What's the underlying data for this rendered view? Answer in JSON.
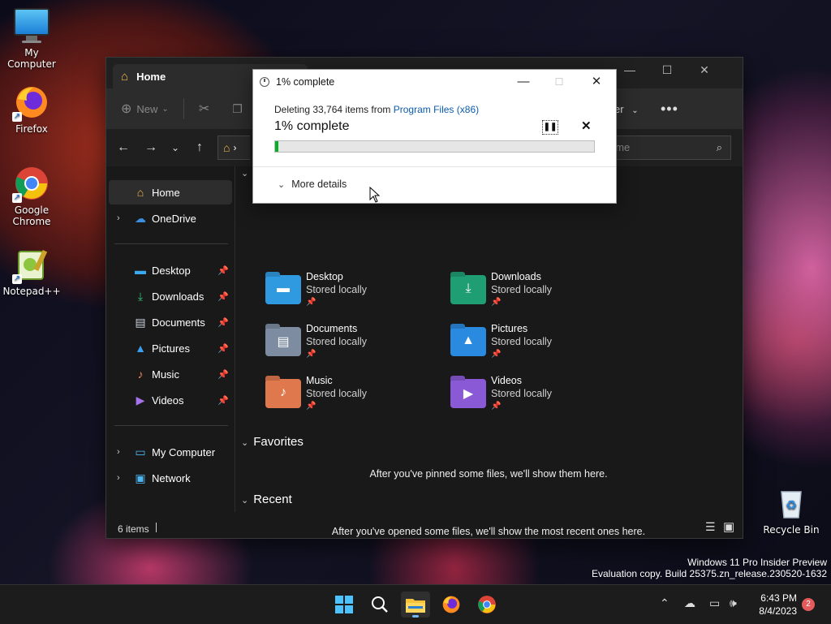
{
  "desktop": {
    "icons": [
      {
        "label": "My Computer"
      },
      {
        "label": "Firefox"
      },
      {
        "label": "Google Chrome"
      },
      {
        "label": "Notepad++"
      },
      {
        "label": "Recycle Bin"
      }
    ]
  },
  "explorer": {
    "tab_title": "Home",
    "toolbar": {
      "new_label": "New",
      "view_fragment": "er"
    },
    "search_placeholder": "ome",
    "sidebar": {
      "top": [
        {
          "label": "Home"
        },
        {
          "label": "OneDrive"
        }
      ],
      "pinned": [
        {
          "label": "Desktop"
        },
        {
          "label": "Downloads"
        },
        {
          "label": "Documents"
        },
        {
          "label": "Pictures"
        },
        {
          "label": "Music"
        },
        {
          "label": "Videos"
        }
      ],
      "bottom": [
        {
          "label": "My Computer"
        },
        {
          "label": "Network"
        }
      ]
    },
    "quick_access": [
      {
        "name": "Desktop",
        "status": "Stored locally",
        "color": "#2f9ae0"
      },
      {
        "name": "Downloads",
        "status": "Stored locally",
        "color": "#1f9e74"
      },
      {
        "name": "Documents",
        "status": "Stored locally",
        "color": "#7d8ca0"
      },
      {
        "name": "Pictures",
        "status": "Stored locally",
        "color": "#2a8ae0"
      },
      {
        "name": "Music",
        "status": "Stored locally",
        "color": "#e0784e"
      },
      {
        "name": "Videos",
        "status": "Stored locally",
        "color": "#8a5ad6"
      }
    ],
    "favorites": {
      "title": "Favorites",
      "empty_text": "After you've pinned some files, we'll show them here."
    },
    "recent": {
      "title": "Recent",
      "empty_text": "After you've opened some files, we'll show the most recent ones here."
    },
    "status": "6 items"
  },
  "dialog": {
    "title": "1% complete",
    "line_prefix": "Deleting 33,764 items from ",
    "line_link": "Program Files (x86)",
    "big_text": "1% complete",
    "progress": 0.01,
    "progress_color": "#06b025",
    "more_details": "More details"
  },
  "taskbar": {
    "time": "6:43 PM",
    "date": "8/4/2023",
    "notification_count": "2"
  },
  "watermark": {
    "line1": "Windows 11 Pro Insider Preview",
    "line2": "Evaluation copy. Build 25375.zn_release.230520-1632"
  }
}
